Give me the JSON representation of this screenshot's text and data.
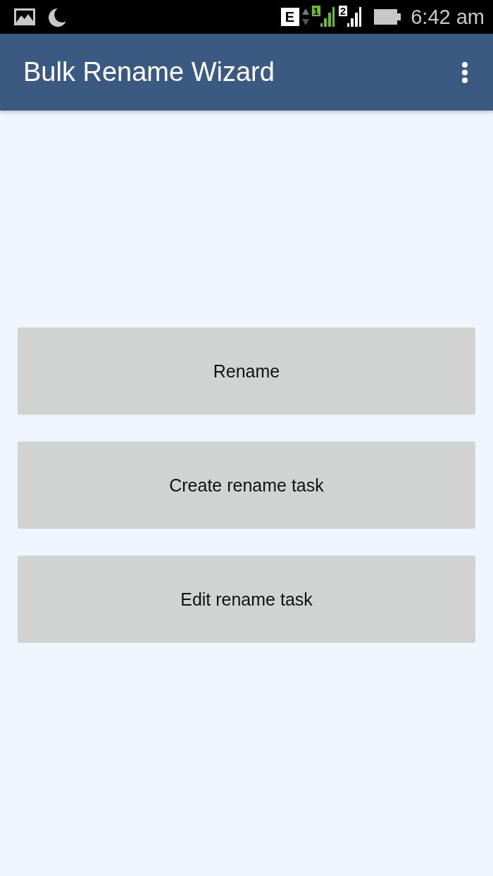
{
  "status_bar": {
    "network_type": "E",
    "sim_1_label": "1",
    "sim_2_label": "2",
    "time": "6:42 am"
  },
  "app_bar": {
    "title": "Bulk Rename Wizard"
  },
  "buttons": [
    {
      "label": "Rename"
    },
    {
      "label": "Create rename task"
    },
    {
      "label": "Edit rename task"
    }
  ]
}
